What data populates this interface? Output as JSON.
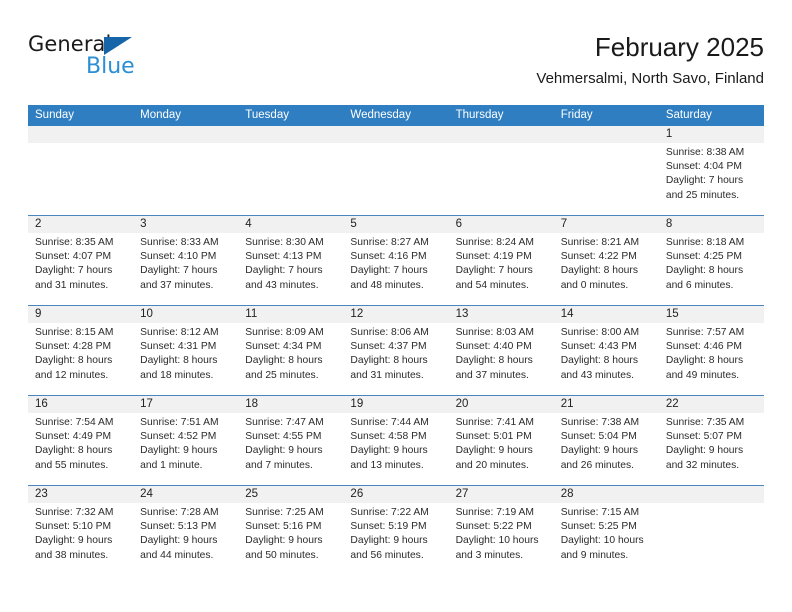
{
  "brand": {
    "name_part1": "General",
    "name_part2": "Blue",
    "triangle_color": "#1565a8",
    "blue_color": "#2b8fd4"
  },
  "header": {
    "month_title": "February 2025",
    "location": "Vehmersalmi, North Savo, Finland"
  },
  "theme": {
    "header_bar_color": "#2f7ec1",
    "row_divider_color": "#4a86bd",
    "daynum_band_color": "#f1f1f1"
  },
  "weekdays": [
    "Sunday",
    "Monday",
    "Tuesday",
    "Wednesday",
    "Thursday",
    "Friday",
    "Saturday"
  ],
  "weeks": [
    [
      {
        "empty": true
      },
      {
        "empty": true
      },
      {
        "empty": true
      },
      {
        "empty": true
      },
      {
        "empty": true
      },
      {
        "empty": true
      },
      {
        "day": "1",
        "sunrise": "Sunrise: 8:38 AM",
        "sunset": "Sunset: 4:04 PM",
        "daylight": "Daylight: 7 hours and 25 minutes."
      }
    ],
    [
      {
        "day": "2",
        "sunrise": "Sunrise: 8:35 AM",
        "sunset": "Sunset: 4:07 PM",
        "daylight": "Daylight: 7 hours and 31 minutes."
      },
      {
        "day": "3",
        "sunrise": "Sunrise: 8:33 AM",
        "sunset": "Sunset: 4:10 PM",
        "daylight": "Daylight: 7 hours and 37 minutes."
      },
      {
        "day": "4",
        "sunrise": "Sunrise: 8:30 AM",
        "sunset": "Sunset: 4:13 PM",
        "daylight": "Daylight: 7 hours and 43 minutes."
      },
      {
        "day": "5",
        "sunrise": "Sunrise: 8:27 AM",
        "sunset": "Sunset: 4:16 PM",
        "daylight": "Daylight: 7 hours and 48 minutes."
      },
      {
        "day": "6",
        "sunrise": "Sunrise: 8:24 AM",
        "sunset": "Sunset: 4:19 PM",
        "daylight": "Daylight: 7 hours and 54 minutes."
      },
      {
        "day": "7",
        "sunrise": "Sunrise: 8:21 AM",
        "sunset": "Sunset: 4:22 PM",
        "daylight": "Daylight: 8 hours and 0 minutes."
      },
      {
        "day": "8",
        "sunrise": "Sunrise: 8:18 AM",
        "sunset": "Sunset: 4:25 PM",
        "daylight": "Daylight: 8 hours and 6 minutes."
      }
    ],
    [
      {
        "day": "9",
        "sunrise": "Sunrise: 8:15 AM",
        "sunset": "Sunset: 4:28 PM",
        "daylight": "Daylight: 8 hours and 12 minutes."
      },
      {
        "day": "10",
        "sunrise": "Sunrise: 8:12 AM",
        "sunset": "Sunset: 4:31 PM",
        "daylight": "Daylight: 8 hours and 18 minutes."
      },
      {
        "day": "11",
        "sunrise": "Sunrise: 8:09 AM",
        "sunset": "Sunset: 4:34 PM",
        "daylight": "Daylight: 8 hours and 25 minutes."
      },
      {
        "day": "12",
        "sunrise": "Sunrise: 8:06 AM",
        "sunset": "Sunset: 4:37 PM",
        "daylight": "Daylight: 8 hours and 31 minutes."
      },
      {
        "day": "13",
        "sunrise": "Sunrise: 8:03 AM",
        "sunset": "Sunset: 4:40 PM",
        "daylight": "Daylight: 8 hours and 37 minutes."
      },
      {
        "day": "14",
        "sunrise": "Sunrise: 8:00 AM",
        "sunset": "Sunset: 4:43 PM",
        "daylight": "Daylight: 8 hours and 43 minutes."
      },
      {
        "day": "15",
        "sunrise": "Sunrise: 7:57 AM",
        "sunset": "Sunset: 4:46 PM",
        "daylight": "Daylight: 8 hours and 49 minutes."
      }
    ],
    [
      {
        "day": "16",
        "sunrise": "Sunrise: 7:54 AM",
        "sunset": "Sunset: 4:49 PM",
        "daylight": "Daylight: 8 hours and 55 minutes."
      },
      {
        "day": "17",
        "sunrise": "Sunrise: 7:51 AM",
        "sunset": "Sunset: 4:52 PM",
        "daylight": "Daylight: 9 hours and 1 minute."
      },
      {
        "day": "18",
        "sunrise": "Sunrise: 7:47 AM",
        "sunset": "Sunset: 4:55 PM",
        "daylight": "Daylight: 9 hours and 7 minutes."
      },
      {
        "day": "19",
        "sunrise": "Sunrise: 7:44 AM",
        "sunset": "Sunset: 4:58 PM",
        "daylight": "Daylight: 9 hours and 13 minutes."
      },
      {
        "day": "20",
        "sunrise": "Sunrise: 7:41 AM",
        "sunset": "Sunset: 5:01 PM",
        "daylight": "Daylight: 9 hours and 20 minutes."
      },
      {
        "day": "21",
        "sunrise": "Sunrise: 7:38 AM",
        "sunset": "Sunset: 5:04 PM",
        "daylight": "Daylight: 9 hours and 26 minutes."
      },
      {
        "day": "22",
        "sunrise": "Sunrise: 7:35 AM",
        "sunset": "Sunset: 5:07 PM",
        "daylight": "Daylight: 9 hours and 32 minutes."
      }
    ],
    [
      {
        "day": "23",
        "sunrise": "Sunrise: 7:32 AM",
        "sunset": "Sunset: 5:10 PM",
        "daylight": "Daylight: 9 hours and 38 minutes."
      },
      {
        "day": "24",
        "sunrise": "Sunrise: 7:28 AM",
        "sunset": "Sunset: 5:13 PM",
        "daylight": "Daylight: 9 hours and 44 minutes."
      },
      {
        "day": "25",
        "sunrise": "Sunrise: 7:25 AM",
        "sunset": "Sunset: 5:16 PM",
        "daylight": "Daylight: 9 hours and 50 minutes."
      },
      {
        "day": "26",
        "sunrise": "Sunrise: 7:22 AM",
        "sunset": "Sunset: 5:19 PM",
        "daylight": "Daylight: 9 hours and 56 minutes."
      },
      {
        "day": "27",
        "sunrise": "Sunrise: 7:19 AM",
        "sunset": "Sunset: 5:22 PM",
        "daylight": "Daylight: 10 hours and 3 minutes."
      },
      {
        "day": "28",
        "sunrise": "Sunrise: 7:15 AM",
        "sunset": "Sunset: 5:25 PM",
        "daylight": "Daylight: 10 hours and 9 minutes."
      },
      {
        "empty": true
      }
    ]
  ]
}
